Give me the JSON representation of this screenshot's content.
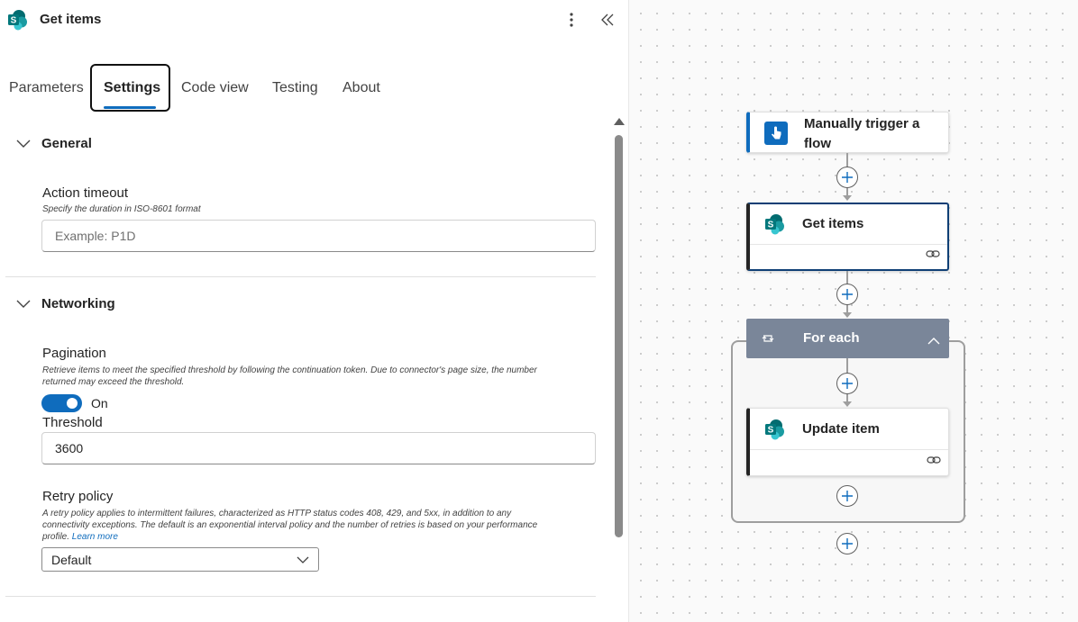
{
  "header": {
    "title": "Get items"
  },
  "tabs": [
    {
      "label": "Parameters"
    },
    {
      "label": "Settings"
    },
    {
      "label": "Code view"
    },
    {
      "label": "Testing"
    },
    {
      "label": "About"
    }
  ],
  "active_tab": "Settings",
  "general": {
    "title": "General",
    "action_timeout": {
      "label": "Action timeout",
      "description": "Specify the duration in ISO-8601 format",
      "placeholder": "Example: P1D",
      "value": ""
    }
  },
  "networking": {
    "title": "Networking",
    "pagination": {
      "label": "Pagination",
      "description_line1": "Retrieve items to meet the specified threshold by following the continuation token. Due to connector's page size, the number",
      "description_line2": "returned may exceed the threshold.",
      "toggle_state": "On",
      "enabled": true
    },
    "threshold": {
      "label": "Threshold",
      "value": "3600"
    },
    "retry_policy": {
      "label": "Retry policy",
      "description_line1": "A retry policy applies to intermittent failures, characterized as HTTP status codes 408, 429, and 5xx, in addition to any",
      "description_line2": "connectivity exceptions. The default is an exponential interval policy and the number of retries is based on your performance",
      "description_line3": "profile.",
      "learn_more": "Learn more",
      "selected": "Default"
    }
  },
  "flow": {
    "trigger": {
      "title_line1": "Manually trigger a",
      "title_line2": "flow"
    },
    "get_items": {
      "title": "Get items"
    },
    "for_each": {
      "title": "For each"
    },
    "update_item": {
      "title": "Update item"
    }
  },
  "colors": {
    "accent": "#0f6cbd",
    "foreach_header": "#7a8699",
    "sharepoint_teal": "#038387"
  },
  "icons": [
    "sharepoint-icon",
    "more-vertical-icon",
    "collapse-panel-icon",
    "chevron-down-icon",
    "manual-trigger-icon",
    "loop-icon",
    "chevron-up-icon",
    "link-icon",
    "plus-icon"
  ]
}
